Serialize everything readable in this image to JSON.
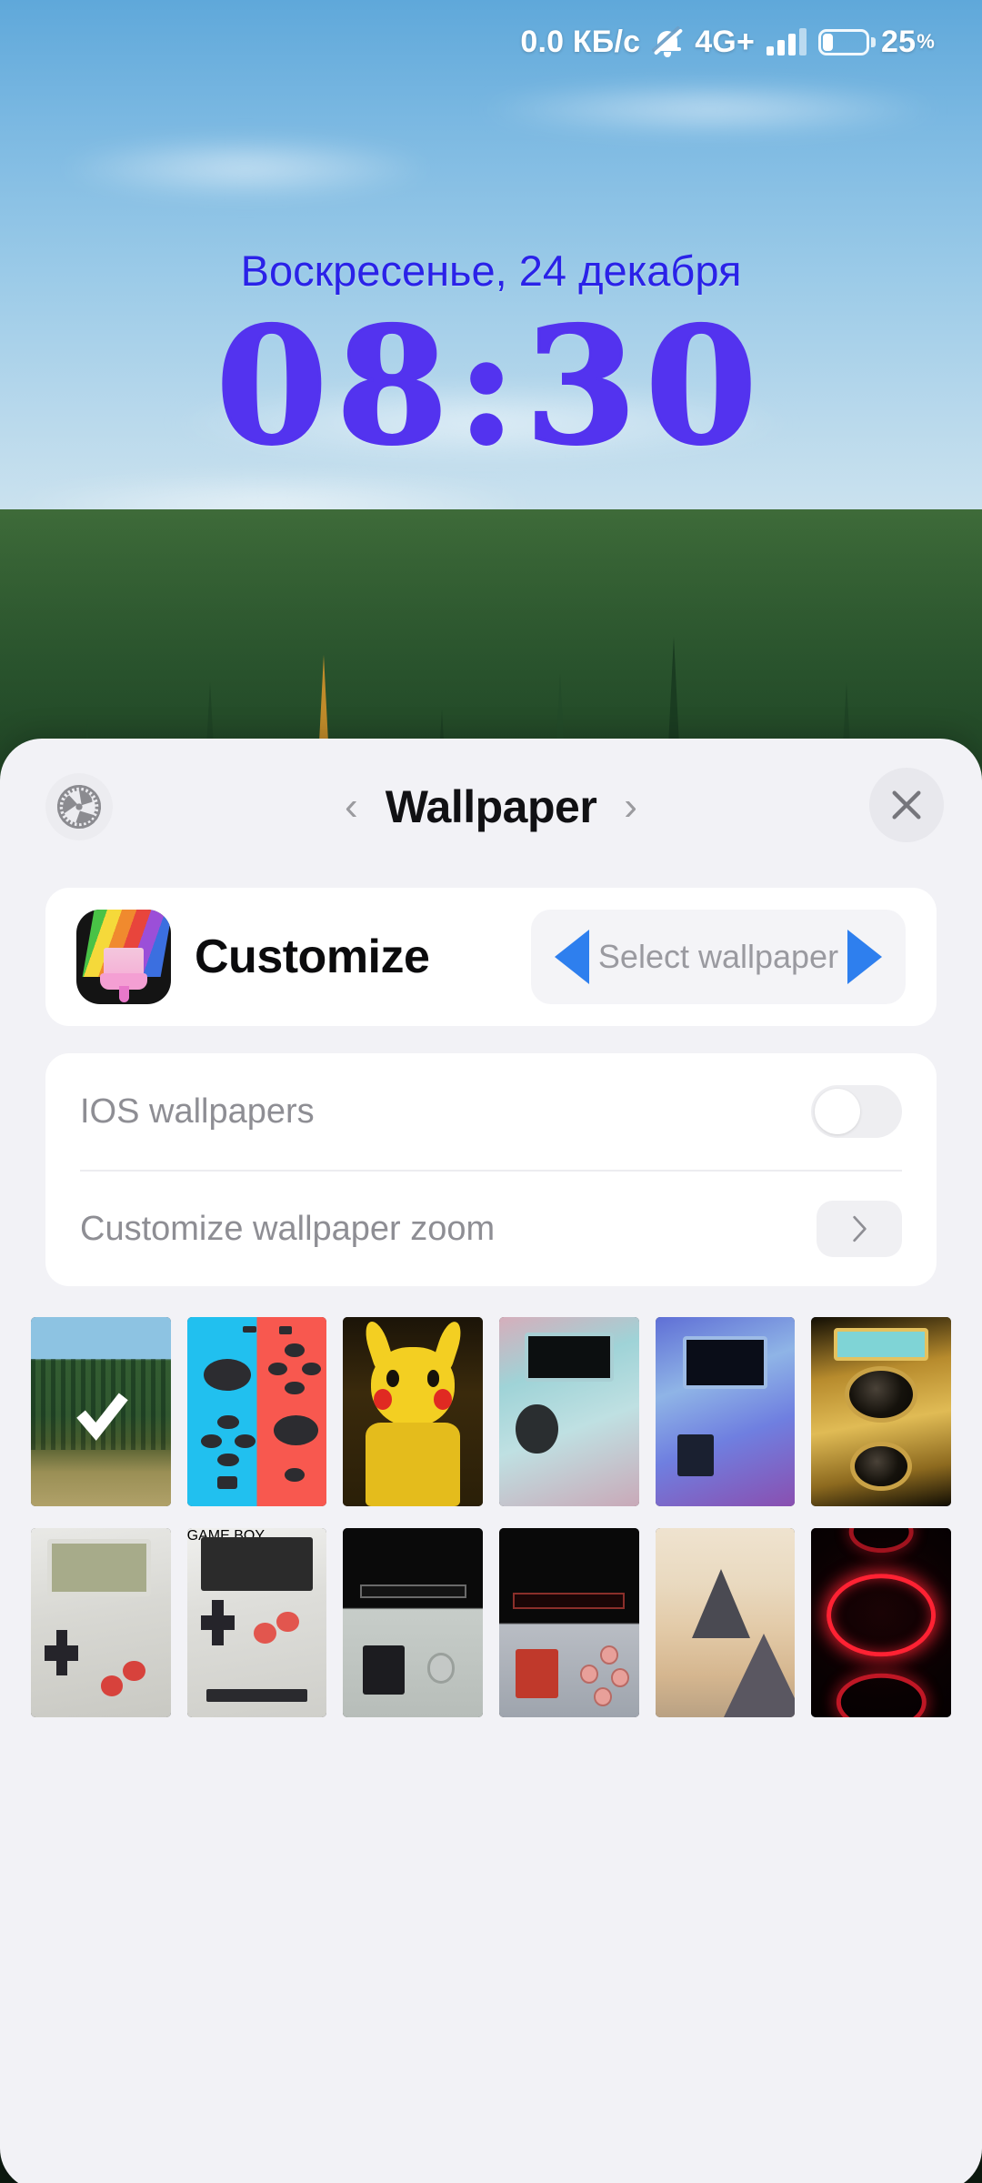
{
  "status_bar": {
    "network_speed": "0.0 КБ/с",
    "mute_icon": "bell-muted-icon",
    "network_type": "4G+",
    "signal_icon": "signal-bars-icon",
    "battery_icon": "battery-icon",
    "battery_percent": "25",
    "battery_percent_symbol": "%"
  },
  "lockscreen": {
    "date": "Воскресенье, 24 декабря",
    "time": "08:30",
    "clock_color": "#5333ef",
    "date_color": "#2a22e8"
  },
  "sheet": {
    "header": {
      "gear_icon": "gear-icon",
      "prev_icon": "‹",
      "title": "Wallpaper",
      "next_icon": "›",
      "close_icon": "close-icon"
    },
    "customize": {
      "app_icon": "paintbrush-app-icon",
      "label": "Customize",
      "prev_arrow": "left-triangle-icon",
      "select_label": "Select wallpaper",
      "next_arrow": "right-triangle-icon"
    },
    "settings": [
      {
        "label": "IOS wallpapers",
        "control": "toggle",
        "value": "off"
      },
      {
        "label": "Customize wallpaper zoom",
        "control": "chevron",
        "value": ""
      }
    ],
    "thumbnails": [
      {
        "name": "forest-autumn-wallpaper",
        "selected": true
      },
      {
        "name": "nintendo-switch-joycon-wallpaper",
        "selected": false
      },
      {
        "name": "pikachu-handheld-wallpaper",
        "selected": false
      },
      {
        "name": "teal-transparent-handheld-wallpaper",
        "selected": false
      },
      {
        "name": "blue-purple-handheld-wallpaper",
        "selected": false
      },
      {
        "name": "gold-speaker-device-wallpaper",
        "selected": false
      },
      {
        "name": "clear-gameboy-wallpaper",
        "selected": false
      },
      {
        "name": "gameboy-classic-wallpaper",
        "selected": false
      },
      {
        "name": "grey-handheld-wallpaper",
        "selected": false
      },
      {
        "name": "red-buttons-handheld-wallpaper",
        "selected": false
      },
      {
        "name": "mountain-clouds-wallpaper",
        "selected": false
      },
      {
        "name": "neon-red-rings-wallpaper",
        "selected": false
      }
    ],
    "thumbnail_labels": {
      "gameboy_text": "GAME BOY"
    }
  },
  "colors": {
    "accent_blue": "#2e7fee",
    "sheet_bg": "#f2f2f6",
    "card_bg": "#ffffff",
    "muted_text": "#8e8e94"
  }
}
